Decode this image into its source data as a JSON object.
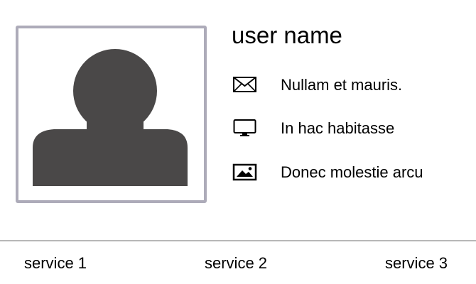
{
  "profile": {
    "avatar_icon": "person-silhouette-icon",
    "user_name": "user name"
  },
  "info": [
    {
      "icon": "envelope-icon",
      "text": "Nullam et mauris."
    },
    {
      "icon": "monitor-icon",
      "text": "In hac habitasse"
    },
    {
      "icon": "image-icon",
      "text": "Donec molestie arcu"
    }
  ],
  "services": [
    {
      "label": "service 1"
    },
    {
      "label": "service 2"
    },
    {
      "label": "service 3"
    }
  ],
  "colors": {
    "frame_border": "#adabb9",
    "silhouette": "#4a4848",
    "divider": "#b7b7b7",
    "text": "#000000"
  }
}
